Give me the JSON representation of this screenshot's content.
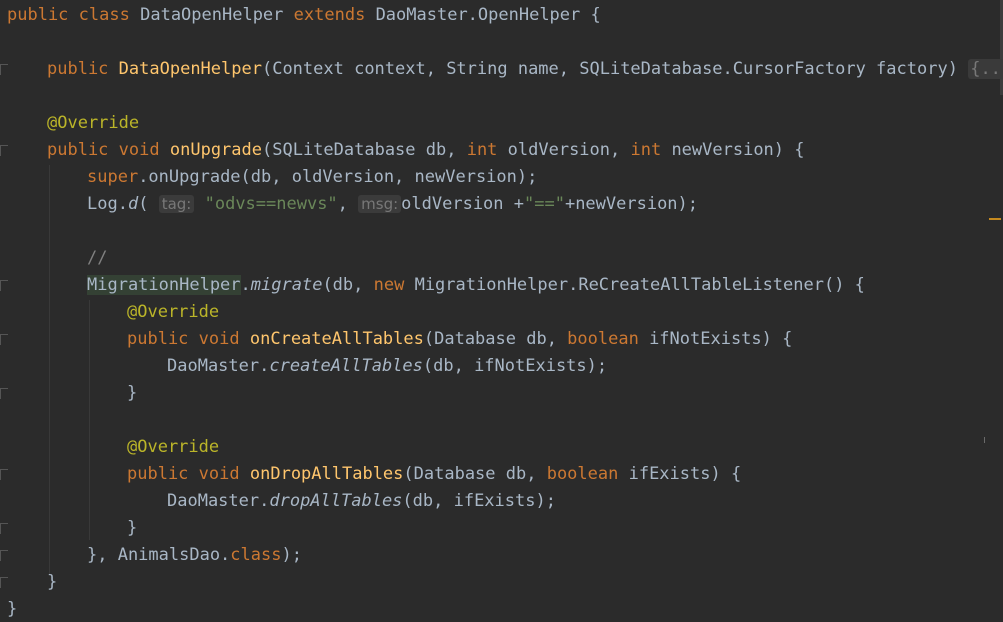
{
  "code": {
    "l1": {
      "kw1": "public",
      "kw2": "class",
      "name": "DataOpenHelper",
      "kw3": "extends",
      "parent": "DaoMaster.OpenHelper {"
    },
    "l2": {
      "kw": "public",
      "fn": "DataOpenHelper",
      "params": "(Context context, String name, SQLiteDatabase.CursorFactory factory)",
      "fold": "{...}"
    },
    "l3": {
      "ann": "@Override"
    },
    "l4": {
      "kw1": "public",
      "kw2": "void",
      "fn": "onUpgrade",
      "p1": "(SQLiteDatabase db, ",
      "kw3": "int",
      "p2": " oldVersion, ",
      "kw4": "int",
      "p3": " newVersion) {"
    },
    "l5": {
      "kw": "super",
      "rest": ".onUpgrade(db, oldVersion, newVersion);"
    },
    "l6": {
      "cls": "Log.",
      "fn": "d",
      "open": "(",
      "hint1": "tag:",
      "str1": "\"odvs==newvs\"",
      "comma": ", ",
      "hint2": "msg:",
      "rest1": "oldVersion +",
      "str2": "\"==\"",
      "rest2": "+newVersion);"
    },
    "l7": {
      "cmt": "//"
    },
    "l8": {
      "cls": "MigrationHelper",
      "dot": ".",
      "fn": "migrate",
      "p1": "(db, ",
      "kw": "new",
      "p2": " MigrationHelper.ReCreateAllTableListener() {"
    },
    "l9": {
      "ann": "@Override"
    },
    "l10": {
      "kw1": "public",
      "kw2": "void",
      "fn": "onCreateAllTables",
      "p1": "(Database db, ",
      "kw3": "boolean",
      "p2": " ifNotExists) {"
    },
    "l11": {
      "cls": "DaoMaster.",
      "fn": "createAllTables",
      "rest": "(db, ifNotExists);"
    },
    "l12": {
      "brace": "}"
    },
    "l13": {
      "ann": "@Override"
    },
    "l14": {
      "kw1": "public",
      "kw2": "void",
      "fn": "onDropAllTables",
      "p1": "(Database db, ",
      "kw3": "boolean",
      "p2": " ifExists) {"
    },
    "l15": {
      "cls": "DaoMaster.",
      "fn": "dropAllTables",
      "rest": "(db, ifExists);"
    },
    "l16": {
      "brace": "}"
    },
    "l17": {
      "p1": "}, AnimalsDao.",
      "kw": "class",
      "p2": ");"
    },
    "l18": {
      "brace": "}"
    },
    "l19": {
      "brace": "}"
    }
  },
  "colors": {
    "background": "#2b2b2b",
    "keyword": "#cc7832",
    "function": "#ffc66d",
    "annotation": "#bbb529",
    "string": "#6a8759",
    "default": "#a9b7c6"
  }
}
